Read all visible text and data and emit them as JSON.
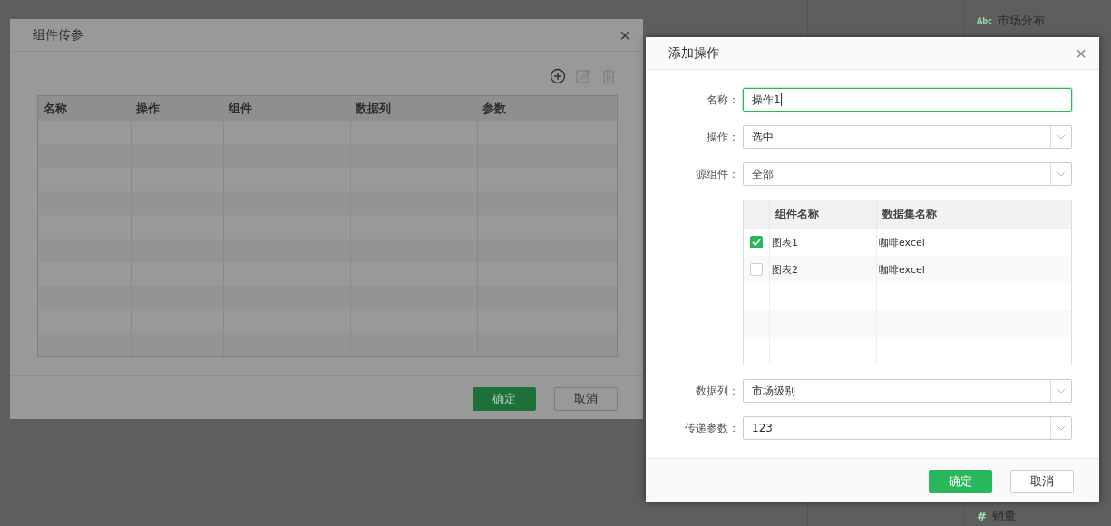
{
  "background_panel": {
    "fields": [
      {
        "kind": "dimension",
        "badge": "Abc",
        "label": "市场分布"
      },
      {
        "kind": "measure",
        "badge": "#",
        "label": "销量"
      }
    ]
  },
  "back_dialog": {
    "title": "组件传参",
    "close": "×",
    "toolbar": [
      {
        "kind": "add",
        "disabled": false
      },
      {
        "kind": "edit",
        "disabled": true
      },
      {
        "kind": "delete",
        "disabled": true
      }
    ],
    "table": {
      "columns": [
        "名称",
        "操作",
        "组件",
        "数据列",
        "参数"
      ]
    },
    "buttons": [
      {
        "label": "确定",
        "primary": true
      },
      {
        "label": "取消",
        "primary": false
      }
    ]
  },
  "dialog": {
    "title": "添加操作",
    "close": "×",
    "fields": [
      {
        "kind": "input",
        "label": "名称：",
        "value": "操作1",
        "focused": true
      },
      {
        "kind": "select",
        "label": "操作：",
        "value": "选中"
      },
      {
        "kind": "select",
        "label": "源组件：",
        "value": "全部"
      },
      {
        "kind": "table",
        "columns": [
          "组件名称",
          "数据集名称"
        ],
        "rows": [
          {
            "checked": true,
            "cells": [
              "图表1",
              "咖啡excel"
            ]
          },
          {
            "checked": false,
            "cells": [
              "图表2",
              "咖啡excel"
            ]
          }
        ]
      },
      {
        "kind": "select",
        "label": "数据列：",
        "value": "市场级别"
      },
      {
        "kind": "select",
        "label": "传递参数：",
        "value": "123"
      }
    ],
    "buttons": [
      {
        "label": "确定",
        "primary": true
      },
      {
        "label": "取消",
        "primary": false
      }
    ]
  }
}
